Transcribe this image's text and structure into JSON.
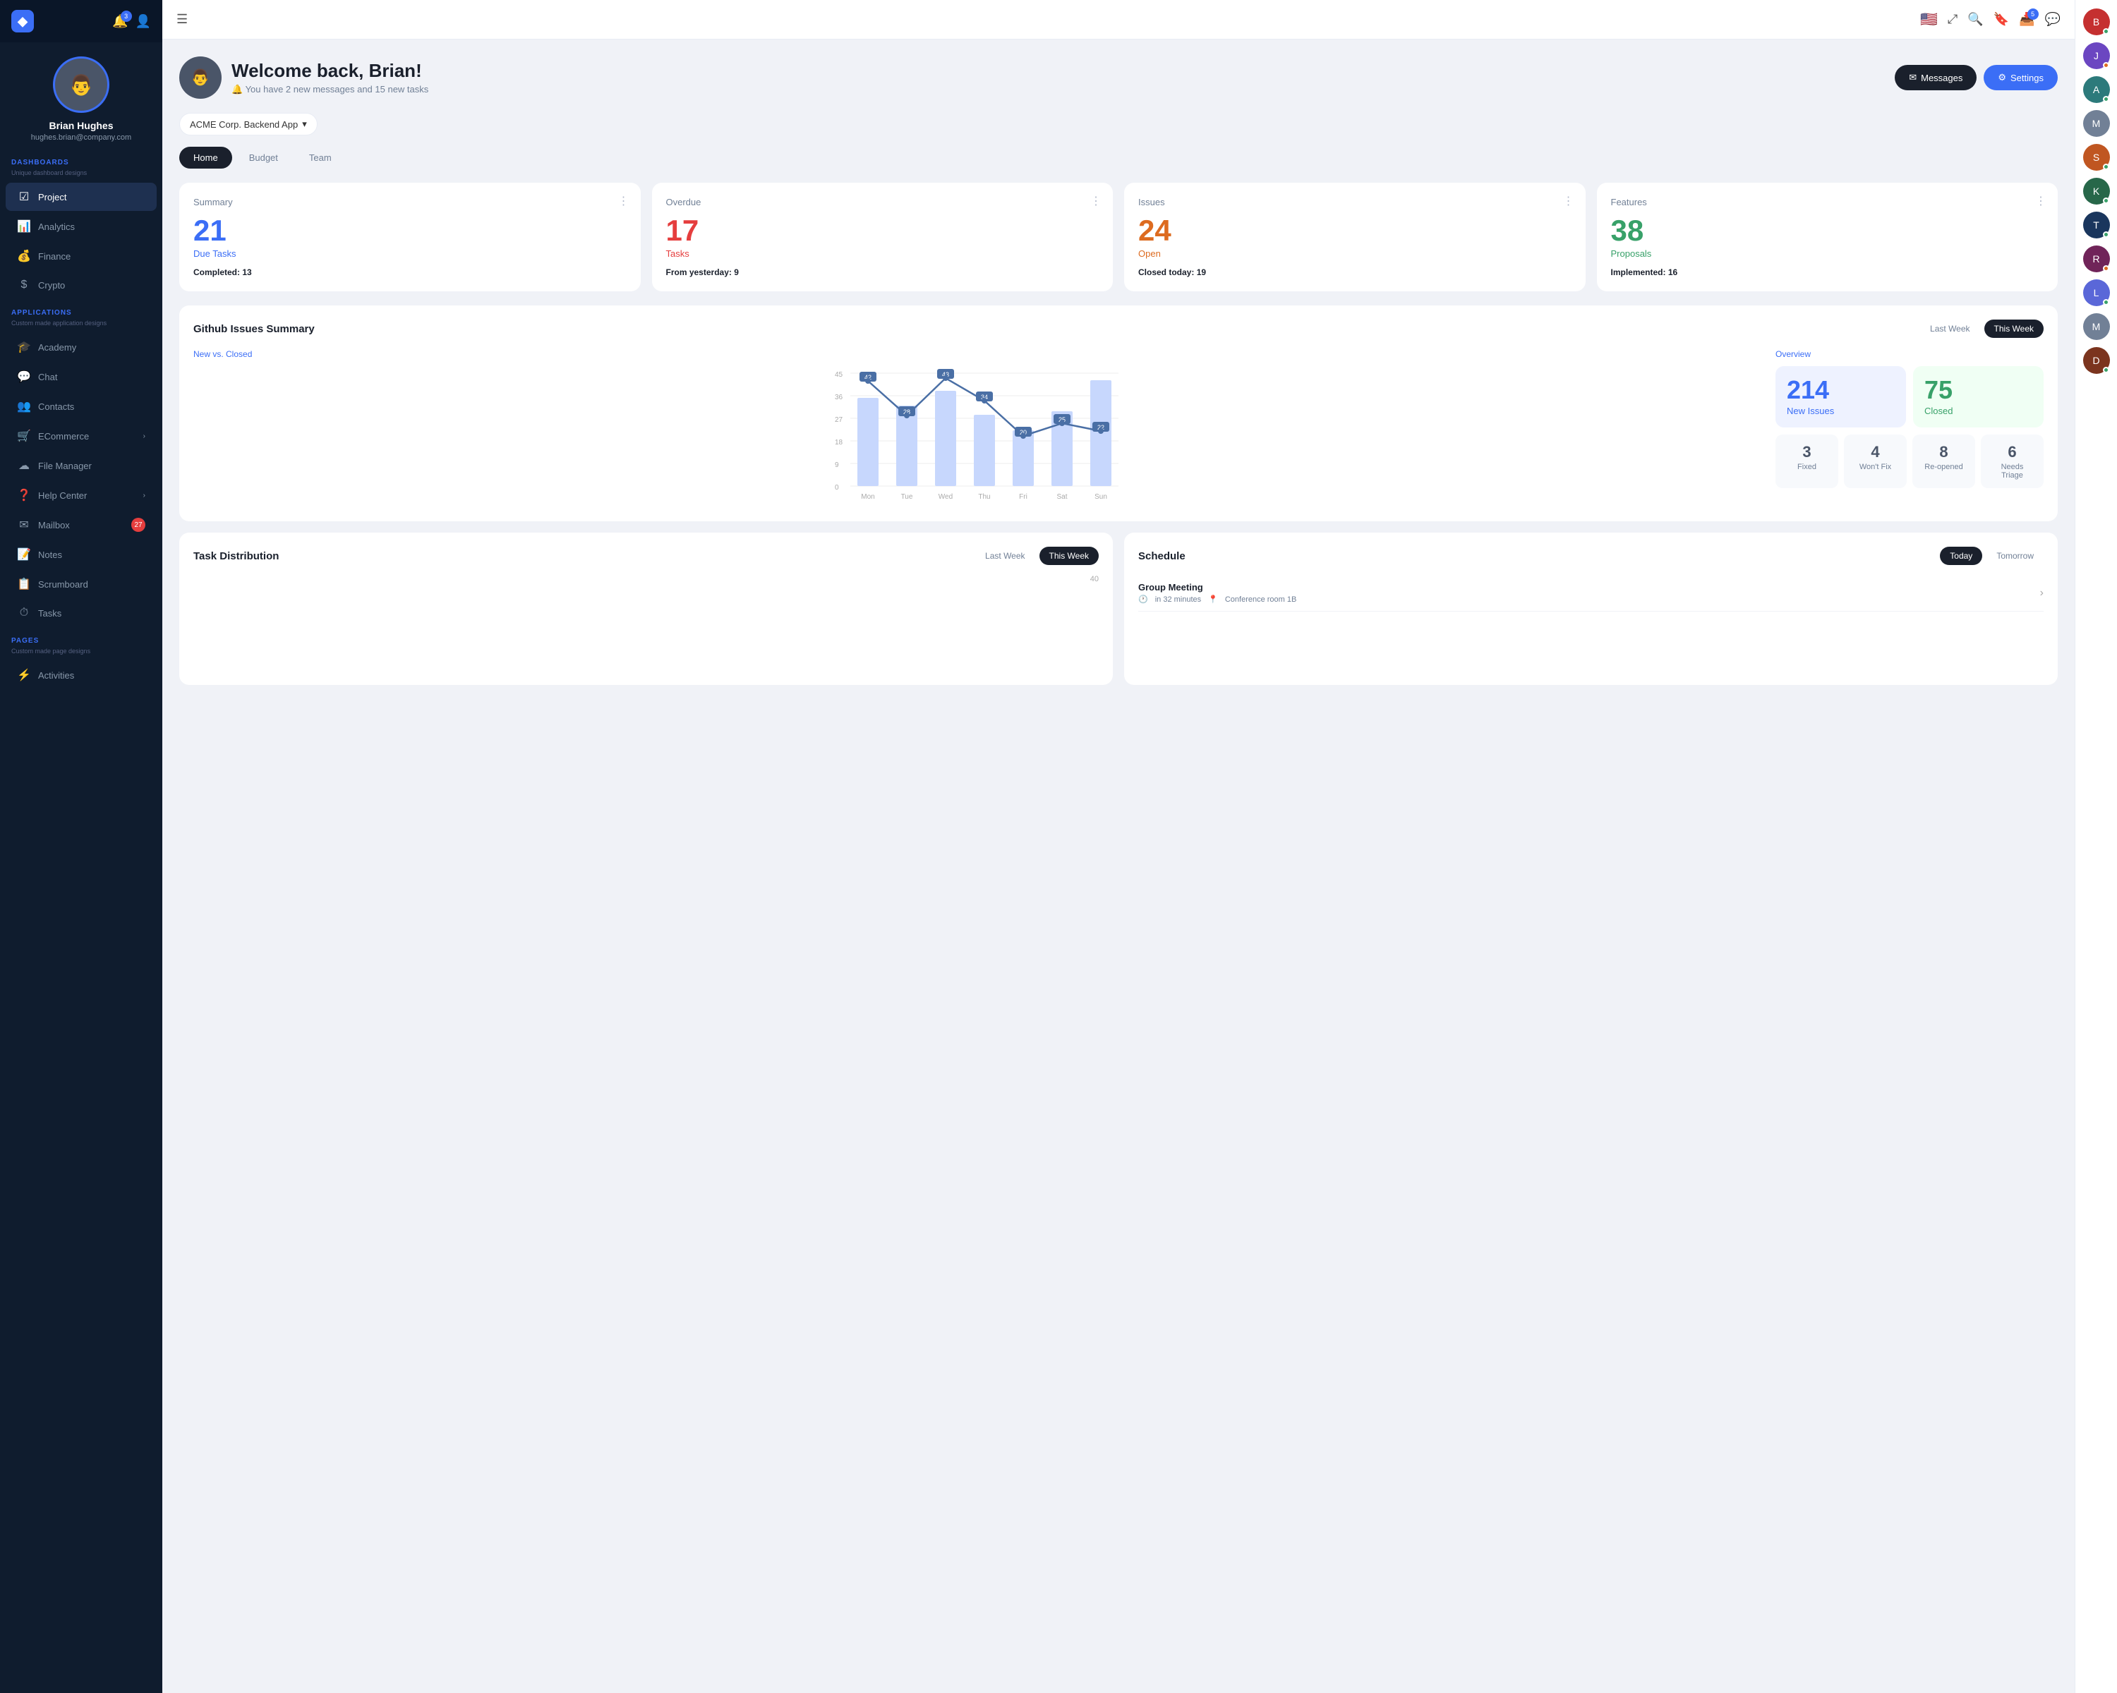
{
  "sidebar": {
    "logo": "◆",
    "notifications_count": "3",
    "profile": {
      "name": "Brian Hughes",
      "email": "hughes.brian@company.com"
    },
    "sections": [
      {
        "label": "DASHBOARDS",
        "sublabel": "Unique dashboard designs",
        "items": [
          {
            "id": "project",
            "icon": "☑",
            "label": "Project",
            "active": true
          },
          {
            "id": "analytics",
            "icon": "📊",
            "label": "Analytics"
          },
          {
            "id": "finance",
            "icon": "💰",
            "label": "Finance"
          },
          {
            "id": "crypto",
            "icon": "$",
            "label": "Crypto"
          }
        ]
      },
      {
        "label": "APPLICATIONS",
        "sublabel": "Custom made application designs",
        "items": [
          {
            "id": "academy",
            "icon": "🎓",
            "label": "Academy"
          },
          {
            "id": "chat",
            "icon": "💬",
            "label": "Chat"
          },
          {
            "id": "contacts",
            "icon": "👥",
            "label": "Contacts"
          },
          {
            "id": "ecommerce",
            "icon": "🛒",
            "label": "ECommerce",
            "arrow": true
          },
          {
            "id": "filemanager",
            "icon": "☁",
            "label": "File Manager"
          },
          {
            "id": "helpcenter",
            "icon": "❓",
            "label": "Help Center",
            "arrow": true
          },
          {
            "id": "mailbox",
            "icon": "✉",
            "label": "Mailbox",
            "badge": "27"
          },
          {
            "id": "notes",
            "icon": "📝",
            "label": "Notes"
          },
          {
            "id": "scrumboard",
            "icon": "📋",
            "label": "Scrumboard"
          },
          {
            "id": "tasks",
            "icon": "⏱",
            "label": "Tasks"
          }
        ]
      },
      {
        "label": "PAGES",
        "sublabel": "Custom made page designs",
        "items": [
          {
            "id": "activities",
            "icon": "⚡",
            "label": "Activities"
          }
        ]
      }
    ]
  },
  "topbar": {
    "menu_icon": "☰",
    "flag": "🇺🇸",
    "fullscreen_icon": "⤢",
    "search_icon": "🔍",
    "bookmark_icon": "🔖",
    "inbox_icon": "📥",
    "inbox_badge": "5",
    "chat_icon": "💬"
  },
  "welcome": {
    "title": "Welcome back, Brian!",
    "subtitle": "You have 2 new messages and 15 new tasks",
    "btn_messages": "Messages",
    "btn_settings": "Settings"
  },
  "project_selector": {
    "label": "ACME Corp. Backend App"
  },
  "tabs": [
    {
      "id": "home",
      "label": "Home",
      "active": true
    },
    {
      "id": "budget",
      "label": "Budget"
    },
    {
      "id": "team",
      "label": "Team"
    }
  ],
  "stats": [
    {
      "id": "summary",
      "title": "Summary",
      "number": "21",
      "label": "Due Tasks",
      "color": "blue",
      "footer_text": "Completed:",
      "footer_value": "13"
    },
    {
      "id": "overdue",
      "title": "Overdue",
      "number": "17",
      "label": "Tasks",
      "color": "red",
      "footer_text": "From yesterday:",
      "footer_value": "9"
    },
    {
      "id": "issues",
      "title": "Issues",
      "number": "24",
      "label": "Open",
      "color": "orange",
      "footer_text": "Closed today:",
      "footer_value": "19"
    },
    {
      "id": "features",
      "title": "Features",
      "number": "38",
      "label": "Proposals",
      "color": "green",
      "footer_text": "Implemented:",
      "footer_value": "16"
    }
  ],
  "github": {
    "title": "Github Issues Summary",
    "last_week": "Last Week",
    "this_week": "This Week",
    "chart": {
      "label": "New vs. Closed",
      "days": [
        "Mon",
        "Tue",
        "Wed",
        "Thu",
        "Fri",
        "Sat",
        "Sun"
      ],
      "line_values": [
        42,
        28,
        43,
        34,
        20,
        25,
        22
      ],
      "bar_values": [
        35,
        30,
        38,
        28,
        22,
        30,
        42
      ],
      "y_labels": [
        "45",
        "36",
        "27",
        "18",
        "9",
        "0"
      ]
    },
    "overview": {
      "label": "Overview",
      "new_issues": "214",
      "new_issues_label": "New Issues",
      "closed": "75",
      "closed_label": "Closed",
      "mini_stats": [
        {
          "id": "fixed",
          "number": "3",
          "label": "Fixed"
        },
        {
          "id": "wont_fix",
          "number": "4",
          "label": "Won't Fix"
        },
        {
          "id": "reopened",
          "number": "8",
          "label": "Re-opened"
        },
        {
          "id": "needs_triage",
          "number": "6",
          "label": "Needs Triage"
        }
      ]
    }
  },
  "task_distribution": {
    "title": "Task Distribution",
    "last_week": "Last Week",
    "this_week": "This Week",
    "y_max": 40
  },
  "schedule": {
    "title": "Schedule",
    "today": "Today",
    "tomorrow": "Tomorrow",
    "items": [
      {
        "id": "group-meeting",
        "title": "Group Meeting",
        "time": "in 32 minutes",
        "location": "Conference room 1B"
      }
    ]
  },
  "right_panel": {
    "avatars": [
      {
        "id": "rp1",
        "initial": "B",
        "color": "#c53030",
        "dot": "green"
      },
      {
        "id": "rp2",
        "initial": "J",
        "color": "#6b46c1",
        "dot": "orange"
      },
      {
        "id": "rp3",
        "initial": "A",
        "color": "#2c7a7b",
        "dot": "green"
      },
      {
        "id": "rp4",
        "initial": "M",
        "color": "#718096",
        "dot": ""
      },
      {
        "id": "rp5",
        "initial": "S",
        "color": "#c05621",
        "dot": "green"
      },
      {
        "id": "rp6",
        "initial": "K",
        "color": "#276749",
        "dot": "green"
      },
      {
        "id": "rp7",
        "initial": "T",
        "color": "#1a365d",
        "dot": "green"
      },
      {
        "id": "rp8",
        "initial": "R",
        "color": "#702459",
        "dot": "orange"
      },
      {
        "id": "rp9",
        "initial": "L",
        "color": "#5a67d8",
        "dot": "green"
      },
      {
        "id": "rp10",
        "initial": "M",
        "color": "#718096",
        "dot": ""
      },
      {
        "id": "rp11",
        "initial": "D",
        "color": "#7b341e",
        "dot": "green"
      }
    ]
  }
}
